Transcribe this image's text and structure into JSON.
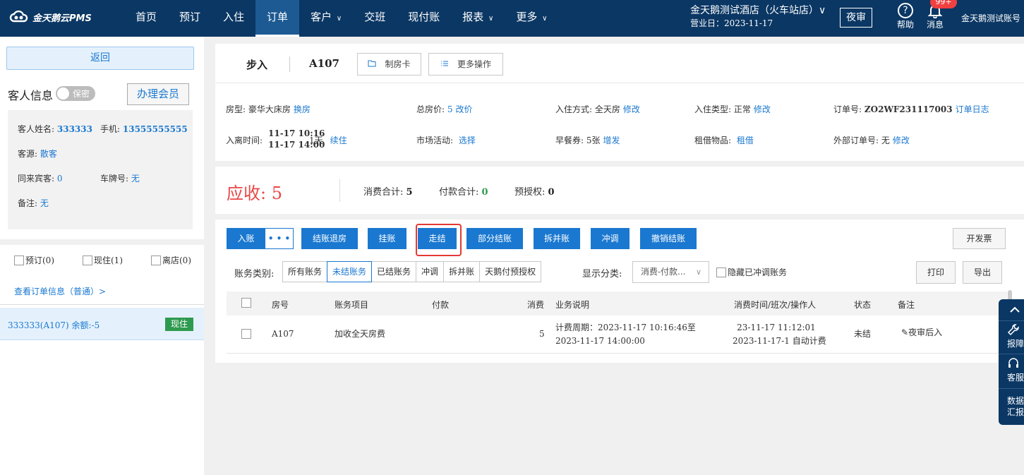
{
  "app": {
    "logo_text": "金天鹅云PMS",
    "nav": [
      {
        "label": "首页"
      },
      {
        "label": "预订"
      },
      {
        "label": "入住"
      },
      {
        "label": "订单"
      },
      {
        "label": "客户",
        "chevron": "∨"
      },
      {
        "label": "交班"
      },
      {
        "label": "现付账"
      },
      {
        "label": "报表",
        "chevron": "∨"
      },
      {
        "label": "更多",
        "chevron": "∨"
      }
    ],
    "hotel_name": "金天鹅测试酒店（火车站店）∨",
    "business_date": "营业日：2023-11-17",
    "night_audit": "夜审",
    "help_label": "帮助",
    "help_icon": "help-circle-icon",
    "message_label": "消息",
    "message_badge": "99+",
    "account_label": "金天鹅测试账号"
  },
  "left_panel": {
    "back_label": "返回",
    "guest_info_title": "客人信息",
    "privacy_toggle": "保密",
    "member_button": "办理会员",
    "guest": {
      "name_label": "客人姓名:",
      "name_value": "333333",
      "phone_label": "手机:",
      "phone_value": "13555555555",
      "source_label": "客源:",
      "source_value": "散客",
      "companions_label": "同来宾客:",
      "companions_value": "0",
      "plate_label": "车牌号:",
      "plate_value": "无",
      "remark_label": "备注:",
      "remark_value": "无"
    },
    "filters": [
      {
        "label": "预订(0)"
      },
      {
        "label": "现住(1)"
      },
      {
        "label": "离店(0)"
      }
    ],
    "view_order_link": "查看订单信息（普通）>",
    "room_entry": {
      "label": "333333(A107)   余额:-5",
      "status": "现住"
    }
  },
  "order_header": {
    "mode": "步入",
    "room_no": "A107",
    "make_card_button": "制房卡",
    "more_actions_button": "更多操作",
    "info": [
      {
        "label": "房型:",
        "value": "豪华大床房",
        "link": "换房"
      },
      {
        "label": "总房价:",
        "value": "5",
        "link": "改价"
      },
      {
        "label": "入住方式:",
        "value": "全天房",
        "link": "修改"
      },
      {
        "label": "入住类型:",
        "value": "正常",
        "link": "修改"
      },
      {
        "label": "订单号:",
        "value": "ZO2WF231117003",
        "link": "订单日志"
      },
      {
        "label": "入离时间:",
        "value_line1": "11-17 10:16",
        "value_line2": "11-17 14:00",
        "nights": "1天",
        "link": "续住"
      },
      {
        "label": "市场活动:",
        "value": "",
        "link": "选择"
      },
      {
        "label": "早餐券:",
        "value": "5张",
        "link": "增发"
      },
      {
        "label": "租借物品:",
        "value": "",
        "link": "租借"
      },
      {
        "label": "外部订单号:",
        "value": "无",
        "link": "修改"
      }
    ]
  },
  "summary": {
    "due_label": "应收:",
    "due_value": "5",
    "consumption_label": "消费合计:",
    "consumption_value": "5",
    "payment_label": "付款合计:",
    "payment_value": "0",
    "preauth_label": "预授权:",
    "preauth_value": "0"
  },
  "billing": {
    "buttons": {
      "post": "入账",
      "post_more": "• • •",
      "checkout": "结账退房",
      "hang": "挂账",
      "walk_settle": "走结",
      "partial": "部分结账",
      "split": "拆并账",
      "adjust": "冲调",
      "cancel_settle": "撤销结账",
      "invoice": "开发票",
      "print": "打印",
      "export": "导出"
    },
    "category_label": "账务类别:",
    "categories": [
      "所有账务",
      "未结账务",
      "已结账务",
      "冲调",
      "拆并账",
      "天鹅付预授权"
    ],
    "active_category": "未结账务",
    "display_label": "显示分类:",
    "display_value": "消费-付款...",
    "hide_adjusted": "隐藏已冲调账务",
    "columns": [
      "房号",
      "账务项目",
      "付款",
      "消费",
      "业务说明",
      "消费时间/班次/操作人",
      "状态",
      "备注"
    ],
    "rows": [
      {
        "room": "A107",
        "item": "加收全天房费",
        "payment": "",
        "consumption": "5",
        "desc_line1": "计费周期：2023-11-17 10:16:46至",
        "desc_line2": "2023-11-17 14:00:00",
        "time_line1": "23-11-17 11:12:01",
        "time_line2": "2023-11-17-1 自动计费",
        "status": "未结",
        "remark": "夜审后入"
      }
    ]
  },
  "side_tools": [
    {
      "label": "报障",
      "icon": "wrench-icon"
    },
    {
      "label": "客服",
      "icon": "headset-icon"
    },
    {
      "label": "数据",
      "label2": "汇报"
    }
  ]
}
